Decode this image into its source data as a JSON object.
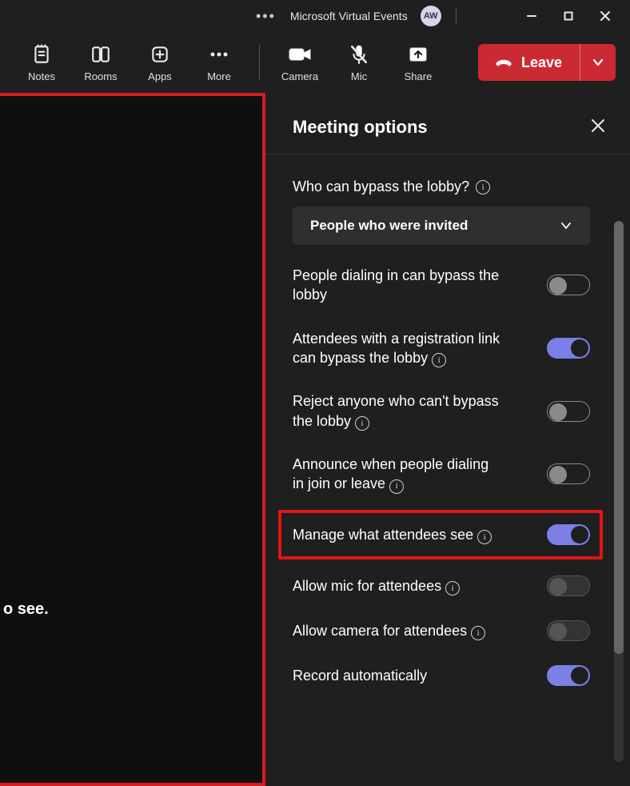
{
  "titlebar": {
    "app_title": "Microsoft Virtual Events",
    "avatar_initials": "AW"
  },
  "toolbar": {
    "notes": "Notes",
    "rooms": "Rooms",
    "apps": "Apps",
    "more": "More",
    "camera": "Camera",
    "mic": "Mic",
    "share": "Share",
    "leave": "Leave"
  },
  "stage": {
    "partial_text": "o see."
  },
  "panel": {
    "title": "Meeting options",
    "lobby_label": "Who can bypass the lobby?",
    "lobby_value": "People who were invited",
    "options": [
      {
        "label": "People dialing in can bypass the lobby",
        "info": false,
        "state": "off"
      },
      {
        "label": "Attendees with a registration link can bypass the lobby",
        "info": true,
        "state": "on"
      },
      {
        "label": "Reject anyone who can't bypass the lobby",
        "info": true,
        "state": "off"
      },
      {
        "label": "Announce when people dialing in join or leave",
        "info": true,
        "state": "off"
      },
      {
        "label": "Manage what attendees see",
        "info": true,
        "state": "on",
        "highlighted": true
      },
      {
        "label": "Allow mic for attendees",
        "info": true,
        "state": "disabled"
      },
      {
        "label": "Allow camera for attendees",
        "info": true,
        "state": "disabled"
      },
      {
        "label": "Record automatically",
        "info": false,
        "state": "on"
      }
    ]
  }
}
